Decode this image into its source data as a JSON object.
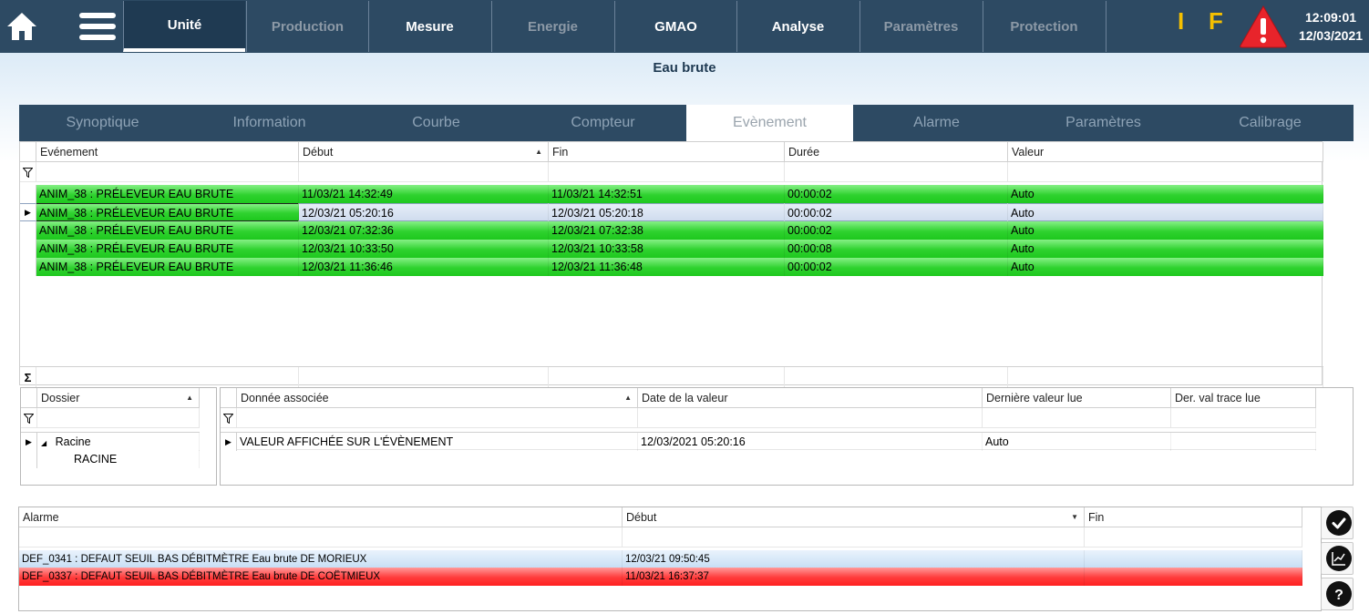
{
  "header": {
    "nav_tabs": [
      {
        "label": "Unité",
        "state": "active"
      },
      {
        "label": "Production",
        "state": "disabled"
      },
      {
        "label": "Mesure",
        "state": "enabled"
      },
      {
        "label": "Energie",
        "state": "disabled"
      },
      {
        "label": "GMAO",
        "state": "enabled"
      },
      {
        "label": "Analyse",
        "state": "enabled"
      },
      {
        "label": "Paramètres",
        "state": "disabled"
      },
      {
        "label": "Protection",
        "state": "disabled"
      }
    ],
    "flag_i": "I",
    "flag_f": "F",
    "time": "12:09:01",
    "date": "12/03/2021",
    "icons": {
      "home": "home-icon",
      "menu": "menu-icon",
      "alarm": "warning-triangle-icon"
    }
  },
  "page": {
    "title": "Eau brute"
  },
  "subtabs": [
    "Synoptique",
    "Information",
    "Courbe",
    "Compteur",
    "Evènement",
    "Alarme",
    "Paramètres",
    "Calibrage"
  ],
  "subtab_active": "Evènement",
  "events": {
    "columns": [
      "Evénement",
      "Début",
      "Fin",
      "Durée",
      "Valeur"
    ],
    "rows": [
      {
        "event": "ANIM_38 : PRÉLEVEUR EAU BRUTE",
        "start": "11/03/21 14:32:49",
        "end": "11/03/21 14:32:51",
        "duration": "00:00:02",
        "value": "Auto",
        "selected": false
      },
      {
        "event": "ANIM_38 : PRÉLEVEUR EAU BRUTE",
        "start": "12/03/21 05:20:16",
        "end": "12/03/21 05:20:18",
        "duration": "00:00:02",
        "value": "Auto",
        "selected": true
      },
      {
        "event": "ANIM_38 : PRÉLEVEUR EAU BRUTE",
        "start": "12/03/21 07:32:36",
        "end": "12/03/21 07:32:38",
        "duration": "00:00:02",
        "value": "Auto",
        "selected": false
      },
      {
        "event": "ANIM_38 : PRÉLEVEUR EAU BRUTE",
        "start": "12/03/21 10:33:50",
        "end": "12/03/21 10:33:58",
        "duration": "00:00:08",
        "value": "Auto",
        "selected": false
      },
      {
        "event": "ANIM_38 : PRÉLEVEUR EAU BRUTE",
        "start": "12/03/21 11:36:46",
        "end": "12/03/21 11:36:48",
        "duration": "00:00:02",
        "value": "Auto",
        "selected": false
      }
    ],
    "sum_symbol": "Σ",
    "filter_symbol": "filter-icon"
  },
  "folders": {
    "column": "Dossier",
    "tree_root": "Racine",
    "tree_child": "RACINE"
  },
  "associated": {
    "columns": [
      "Donnée associée",
      "Date de la valeur",
      "Dernière valeur lue",
      "Der. val trace lue"
    ],
    "rows": [
      {
        "name": "VALEUR AFFICHÉE SUR L'ÉVÈNEMENT",
        "date": "12/03/2021 05:20:16",
        "last": "Auto",
        "trace": ""
      }
    ]
  },
  "alarms": {
    "columns": [
      "Alarme",
      "Début",
      "Fin"
    ],
    "rows": [
      {
        "alarm": "DEF_0341 : DEFAUT SEUIL BAS DÉBITMÈTRE Eau brute DE MORIEUX",
        "start": "12/03/21 09:50:45",
        "end": "",
        "status": "acknowledged"
      },
      {
        "alarm": "DEF_0337 : DEFAUT SEUIL BAS DÉBITMÈTRE Eau brute DE COËTMIEUX",
        "start": "11/03/21 16:37:37",
        "end": "",
        "status": "active"
      }
    ],
    "buttons": [
      "checkmark-icon",
      "trend-chart-icon",
      "help-icon"
    ]
  },
  "colors": {
    "topbar": "#2d4a63",
    "green_row": "#1ec81e",
    "red_row": "#ff2020",
    "flag": "#f5c000",
    "alarm": "#e8242b"
  }
}
